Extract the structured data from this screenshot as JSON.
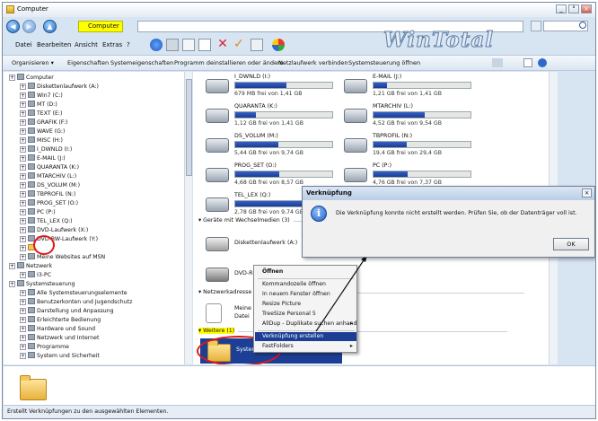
{
  "window": {
    "title": "Computer",
    "controls": [
      "_",
      "°",
      "×"
    ]
  },
  "address": {
    "value": "Computer",
    "search_icon": "search-icon"
  },
  "branding": {
    "logo_text": "WinTotal"
  },
  "menubar": [
    "Datei",
    "Bearbeiten",
    "Ansicht",
    "Extras",
    "?"
  ],
  "commandbar": {
    "items": [
      "Organisieren ▾",
      "Eigenschaften",
      "Systemeigenschaften",
      "Programm deinstallieren oder ändern",
      "Netzlaufwerk verbinden",
      "Systemsteuerung öffnen"
    ]
  },
  "tree": {
    "items": [
      {
        "label": "Computer",
        "indent": 0,
        "icon": "computer-icon",
        "highlight": false
      },
      {
        "label": "Diskettenlaufwerk (A:)",
        "indent": 1,
        "icon": "floppy-icon",
        "highlight": false
      },
      {
        "label": "Win7 (C:)",
        "indent": 1,
        "icon": "drive-icon",
        "highlight": false
      },
      {
        "label": "MT (D:)",
        "indent": 1,
        "icon": "drive-icon",
        "highlight": false
      },
      {
        "label": "TEXT (E:)",
        "indent": 1,
        "icon": "drive-icon",
        "highlight": false
      },
      {
        "label": "GRAFIK (F:)",
        "indent": 1,
        "icon": "drive-icon",
        "highlight": false
      },
      {
        "label": "WAVE (G:)",
        "indent": 1,
        "icon": "drive-icon",
        "highlight": false
      },
      {
        "label": "MISC (H:)",
        "indent": 1,
        "icon": "drive-icon",
        "highlight": false
      },
      {
        "label": "I_DWNLD (I:)",
        "indent": 1,
        "icon": "drive-icon",
        "highlight": false
      },
      {
        "label": "E-MAIL (J:)",
        "indent": 1,
        "icon": "drive-icon",
        "highlight": false
      },
      {
        "label": "QUARANTA (K:)",
        "indent": 1,
        "icon": "drive-icon",
        "highlight": false
      },
      {
        "label": "MTARCHIV (L:)",
        "indent": 1,
        "icon": "drive-icon",
        "highlight": false
      },
      {
        "label": "DS_VOLUM (M:)",
        "indent": 1,
        "icon": "drive-icon",
        "highlight": false
      },
      {
        "label": "TBPROFIL (N:)",
        "indent": 1,
        "icon": "drive-icon",
        "highlight": false
      },
      {
        "label": "PROG_SET (O:)",
        "indent": 1,
        "icon": "drive-icon",
        "highlight": false
      },
      {
        "label": "PC (P:)",
        "indent": 1,
        "icon": "drive-icon",
        "highlight": false
      },
      {
        "label": "TEL_LEX (Q:)",
        "indent": 1,
        "icon": "drive-icon",
        "highlight": false
      },
      {
        "label": "DVD-Laufwerk (X:)",
        "indent": 1,
        "icon": "dvd-icon",
        "highlight": false
      },
      {
        "label": "DVD-RW-Laufwerk (Y:)",
        "indent": 1,
        "icon": "dvd-icon",
        "highlight": false
      },
      {
        "label": "",
        "indent": 1,
        "icon": "folder-icon",
        "highlight": false
      },
      {
        "label": "Meine Websites auf MSN",
        "indent": 1,
        "icon": "web-icon",
        "highlight": false
      },
      {
        "label": "Netzwerk",
        "indent": 0,
        "icon": "network-icon",
        "highlight": false
      },
      {
        "label": "I3-PC",
        "indent": 1,
        "icon": "computer-icon",
        "highlight": false
      },
      {
        "label": "Systemsteuerung",
        "indent": 0,
        "icon": "control-panel-icon",
        "highlight": false
      },
      {
        "label": "Alle Systemsteuerungselemente",
        "indent": 1,
        "icon": "control-panel-icon",
        "highlight": false
      },
      {
        "label": "Benutzerkonten und Jugendschutz",
        "indent": 1,
        "icon": "users-icon",
        "highlight": false
      },
      {
        "label": "Darstellung und Anpassung",
        "indent": 1,
        "icon": "display-icon",
        "highlight": false
      },
      {
        "label": "Erleichterte Bedienung",
        "indent": 1,
        "icon": "accessibility-icon",
        "highlight": false
      },
      {
        "label": "Hardware und Sound",
        "indent": 1,
        "icon": "hardware-icon",
        "highlight": false
      },
      {
        "label": "Netzwerk und Internet",
        "indent": 1,
        "icon": "network-icon",
        "highlight": false
      },
      {
        "label": "Programme",
        "indent": 1,
        "icon": "programs-icon",
        "highlight": false
      },
      {
        "label": "System und Sicherheit",
        "indent": 1,
        "icon": "security-icon",
        "highlight": false
      }
    ]
  },
  "drives": [
    {
      "name": "I_DWNLD (I:)",
      "free": "679 MB frei von 1,41 GB",
      "used_fraction": 0.53
    },
    {
      "name": "E-MAIL (J:)",
      "free": "1,21 GB frei von 1,41 GB",
      "used_fraction": 0.14
    },
    {
      "name": "QUARANTA (K:)",
      "free": "1,12 GB frei von 1,41 GB",
      "used_fraction": 0.21
    },
    {
      "name": "MTARCHIV (L:)",
      "free": "4,52 GB frei von 9,54 GB",
      "used_fraction": 0.53
    },
    {
      "name": "DS_VOLUM (M:)",
      "free": "5,44 GB frei von 9,74 GB",
      "used_fraction": 0.44
    },
    {
      "name": "TBPROFIL (N:)",
      "free": "19,4 GB frei von 29,4 GB",
      "used_fraction": 0.34
    },
    {
      "name": "PROG_SET (O:)",
      "free": "4,68 GB frei von 8,57 GB",
      "used_fraction": 0.45
    },
    {
      "name": "PC (P:)",
      "free": "4,76 GB frei von 7,37 GB",
      "used_fraction": 0.35
    },
    {
      "name": "TEL_LEX (Q:)",
      "free": "2,78 GB frei von 9,74 GB",
      "used_fraction": 0.71
    }
  ],
  "groups": {
    "removable": "Geräte mit Wechselmedien (3)",
    "network": "Netzwerkadresse",
    "further": "Weitere (1)"
  },
  "removable": {
    "floppy": "Diskettenlaufwerk (A:)",
    "dvd": "DVD-R"
  },
  "network_item": {
    "line1": "Meine",
    "line2": "Datei"
  },
  "further_item": {
    "label": "Systemordner"
  },
  "context_menu": {
    "items": [
      {
        "label": "Öffnen",
        "bold": true,
        "submenu": false,
        "highlight": false
      },
      {
        "label": "Kommandozeile öffnen",
        "bold": false,
        "submenu": false,
        "highlight": false
      },
      {
        "label": "In neuem Fenster öffnen",
        "bold": false,
        "submenu": false,
        "highlight": false
      },
      {
        "label": "Resize Picture",
        "bold": false,
        "submenu": false,
        "highlight": false
      },
      {
        "label": "TreeSize Personal 5",
        "bold": false,
        "submenu": false,
        "highlight": false
      },
      {
        "label": "AllDup - Duplikate suchen anhand",
        "bold": false,
        "submenu": true,
        "highlight": false
      },
      {
        "label": "Verknüpfung erstellen",
        "bold": false,
        "submenu": false,
        "highlight": true
      },
      {
        "label": "FastFolders",
        "bold": false,
        "submenu": true,
        "highlight": false
      }
    ]
  },
  "dialog": {
    "title": "Verknüpfung",
    "message": "Die Verknüpfung konnte nicht erstellt werden. Prüfen Sie, ob der Datenträger voll ist.",
    "ok_label": "OK",
    "close_label": "×",
    "info_glyph": "i"
  },
  "status_bar": {
    "text": "Erstellt Verknüpfungen zu den ausgewählten Elementen."
  },
  "colors": {
    "highlight_yellow": "#ffff00",
    "annotation_red": "#e01818",
    "selection_blue": "#1c3f95",
    "drive_bar_blue": "#1b3c96"
  }
}
